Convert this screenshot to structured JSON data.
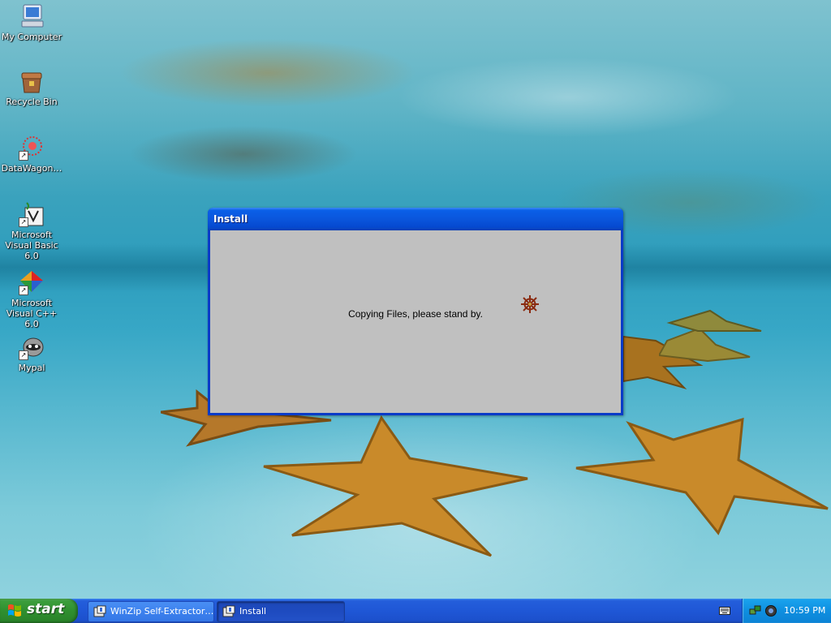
{
  "desktop": {
    "icons": [
      {
        "label": "My Computer",
        "icon": "my-computer-icon"
      },
      {
        "label": "Recycle Bin",
        "icon": "recycle-bin-icon"
      },
      {
        "label": "DataWagon…",
        "icon": "datawagon-icon"
      },
      {
        "label": "Microsoft Visual Basic 6.0",
        "icon": "visual-basic-icon"
      },
      {
        "label": "Microsoft Visual C++ 6.0",
        "icon": "visual-cpp-icon"
      },
      {
        "label": "Mypal",
        "icon": "mypal-icon"
      }
    ]
  },
  "window": {
    "title": "Install",
    "message": "Copying Files, please stand by.",
    "icon": "ship-wheel-icon"
  },
  "taskbar": {
    "start_label": "start",
    "tasks": [
      {
        "label": "WinZip Self-Extractor…",
        "icon": "winzip-icon",
        "active": false
      },
      {
        "label": "Install",
        "icon": "install-icon",
        "active": true
      }
    ],
    "clock": "10:59 PM"
  },
  "colors": {
    "titlebar": "#0a56dc",
    "start_button": "#2f8f2f",
    "taskbar": "#1f57d6",
    "tray": "#0f8fe0",
    "dialog_body": "#c0c0c0"
  }
}
